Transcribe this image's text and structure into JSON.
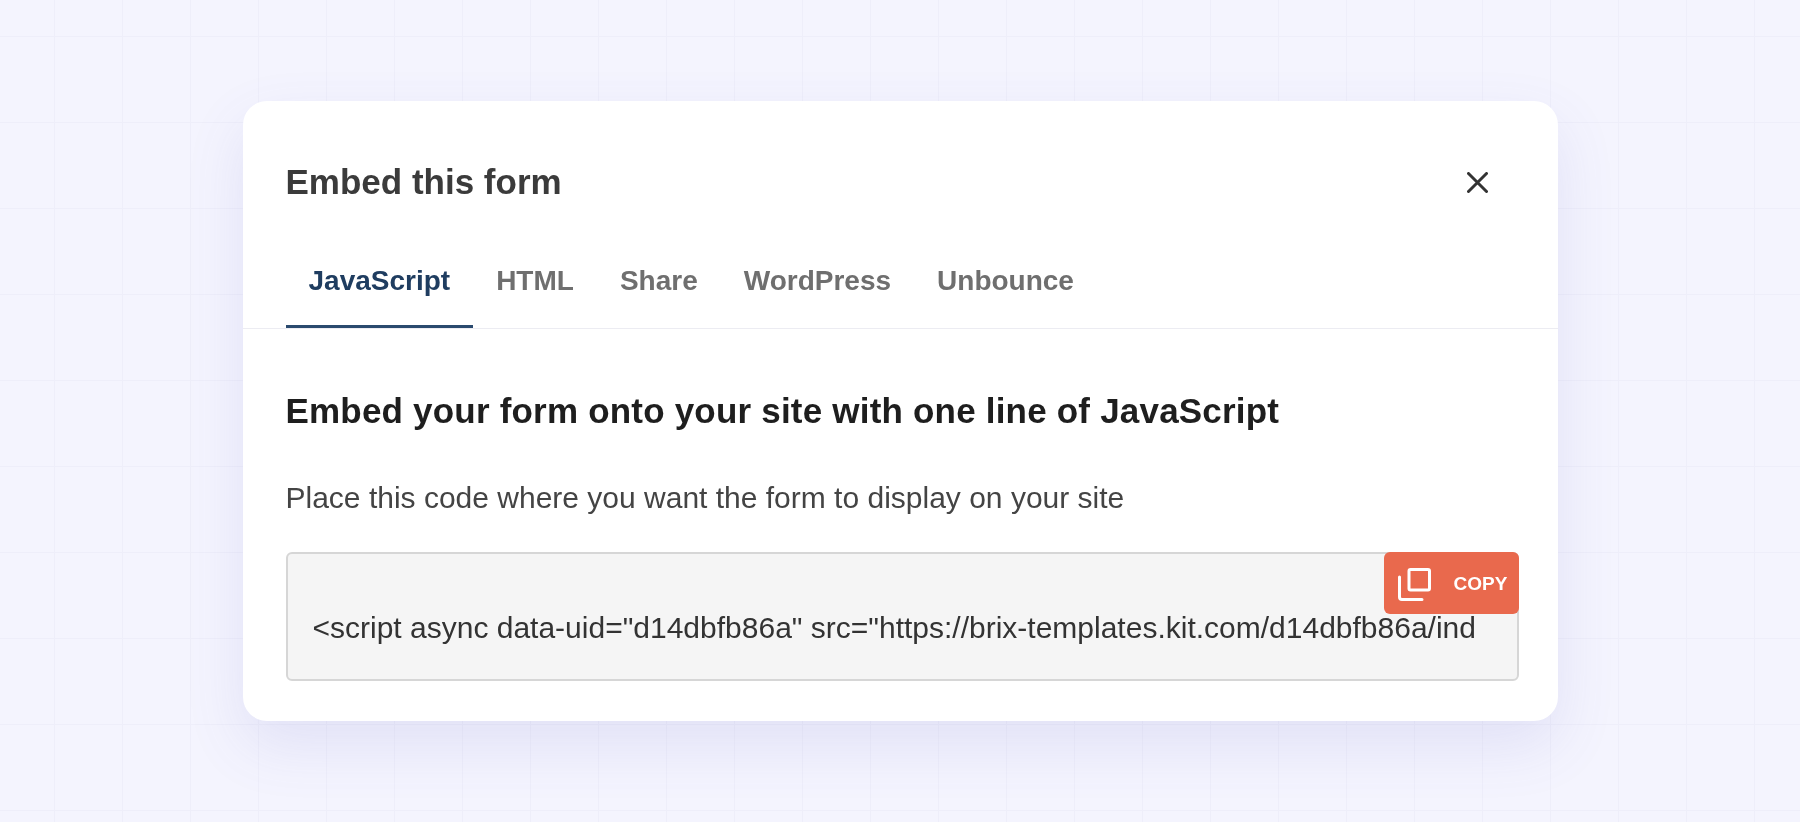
{
  "dialog": {
    "title": "Embed this form"
  },
  "tabs": [
    {
      "label": "JavaScript",
      "selected": true
    },
    {
      "label": "HTML",
      "selected": false
    },
    {
      "label": "Share",
      "selected": false
    },
    {
      "label": "WordPress",
      "selected": false
    },
    {
      "label": "Unbounce",
      "selected": false
    }
  ],
  "panel": {
    "heading": "Embed your form onto your site with one line of JavaScript",
    "description": "Place this code where you want the form to display on your site",
    "code_field": {
      "value": "<script async data-uid=\"d14dbfb86a\" src=\"https://brix-templates.kit.com/d14dbfb86a/ind"
    },
    "copy_button": {
      "label": "COPY"
    }
  }
}
